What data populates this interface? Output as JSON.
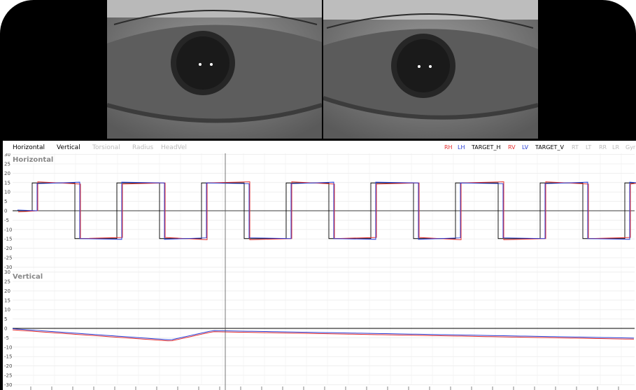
{
  "tabs": [
    {
      "label": "Horizontal",
      "active": true
    },
    {
      "label": "Vertical",
      "active": true
    },
    {
      "label": "Torsional",
      "active": false
    },
    {
      "label": "Radius",
      "active": false
    },
    {
      "label": "HeadVel",
      "active": false
    }
  ],
  "legend": [
    {
      "label": "RH",
      "color": "#e53030"
    },
    {
      "label": "LH",
      "color": "#2a3fd6"
    },
    {
      "label": "TARGET_H",
      "color": "#000000"
    },
    {
      "label": "RV",
      "color": "#e53030"
    },
    {
      "label": "LV",
      "color": "#2a3fd6"
    },
    {
      "label": "TARGET_V",
      "color": "#000000"
    },
    {
      "label": "RT",
      "color": "#bbbbbb"
    },
    {
      "label": "LT",
      "color": "#bbbbbb"
    },
    {
      "label": "RR",
      "color": "#bbbbbb"
    },
    {
      "label": "LR",
      "color": "#bbbbbb"
    },
    {
      "label": "Gyr",
      "color": "#bbbbbb"
    }
  ],
  "panels": {
    "horizontal_title": "Horizontal",
    "vertical_title": "Vertical",
    "yticks": [
      "30",
      "25",
      "20",
      "15",
      "10",
      "5",
      "0",
      "-5",
      "-10",
      "-15",
      "-20",
      "-25",
      "-30"
    ]
  },
  "colors": {
    "right_eye": "#e53030",
    "left_eye": "#2a3fd6",
    "target": "#000000"
  }
}
